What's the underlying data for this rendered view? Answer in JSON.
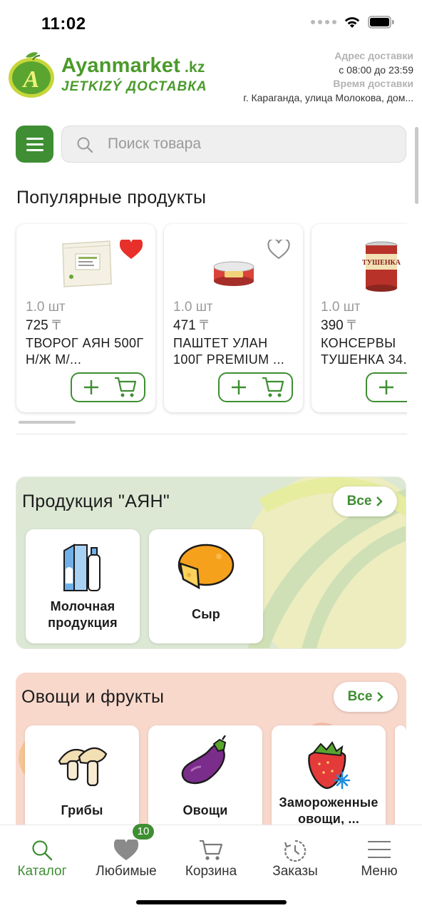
{
  "status_bar": {
    "time": "11:02"
  },
  "header": {
    "brand_name": "Ayanmarket",
    "brand_domain": ".kz",
    "brand_tagline": "JETKIZÝ ДОСТАВКА",
    "delivery_address_label": "Адрес доставки",
    "delivery_hours": "с 08:00 до 23:59",
    "delivery_time_label": "Время доставки",
    "delivery_address": "г. Караганда, улица Молокова, дом..."
  },
  "search": {
    "placeholder": "Поиск товара",
    "value": ""
  },
  "popular": {
    "title": "Популярные продукты",
    "currency": "₸",
    "products": [
      {
        "qty": "1.0 шт",
        "price": "725",
        "name": "ТВОРОГ АЯН 500Г Н/Ж М/...",
        "favorite": true
      },
      {
        "qty": "1.0 шт",
        "price": "471",
        "name": "ПАШТЕТ УЛАН 100Г PREMIUM ...",
        "favorite": false
      },
      {
        "qty": "1.0 шт",
        "price": "390",
        "name": "КОНСЕРВЫ ТУШЕНКА 34...",
        "favorite": false
      }
    ]
  },
  "categories": [
    {
      "title": "Продукция \"АЯН\"",
      "all_label": "Все",
      "color": "#dce8d4",
      "items": [
        {
          "label": "Молочная продукция",
          "icon": "milk-icon"
        },
        {
          "label": "Сыр",
          "icon": "cheese-icon"
        }
      ]
    },
    {
      "title": "Овощи и фрукты",
      "all_label": "Все",
      "color": "#f9d8cc",
      "items": [
        {
          "label": "Грибы",
          "icon": "mushroom-icon"
        },
        {
          "label": "Овощи",
          "icon": "eggplant-icon"
        },
        {
          "label": "Замороженные овощи, ...",
          "icon": "frozen-strawberry-icon"
        }
      ]
    }
  ],
  "bottom_nav": {
    "items": [
      {
        "label": "Каталог",
        "icon": "search-icon",
        "active": true
      },
      {
        "label": "Любимые",
        "icon": "heart-icon",
        "active": false
      },
      {
        "label": "Корзина",
        "icon": "cart-icon",
        "active": false
      },
      {
        "label": "Заказы",
        "icon": "history-icon",
        "active": false
      },
      {
        "label": "Меню",
        "icon": "menu-icon",
        "active": false
      }
    ],
    "favorites_badge": "10"
  },
  "colors": {
    "accent": "#3f8e33",
    "brand": "#4b9a2b",
    "heart": "#e8302b"
  }
}
